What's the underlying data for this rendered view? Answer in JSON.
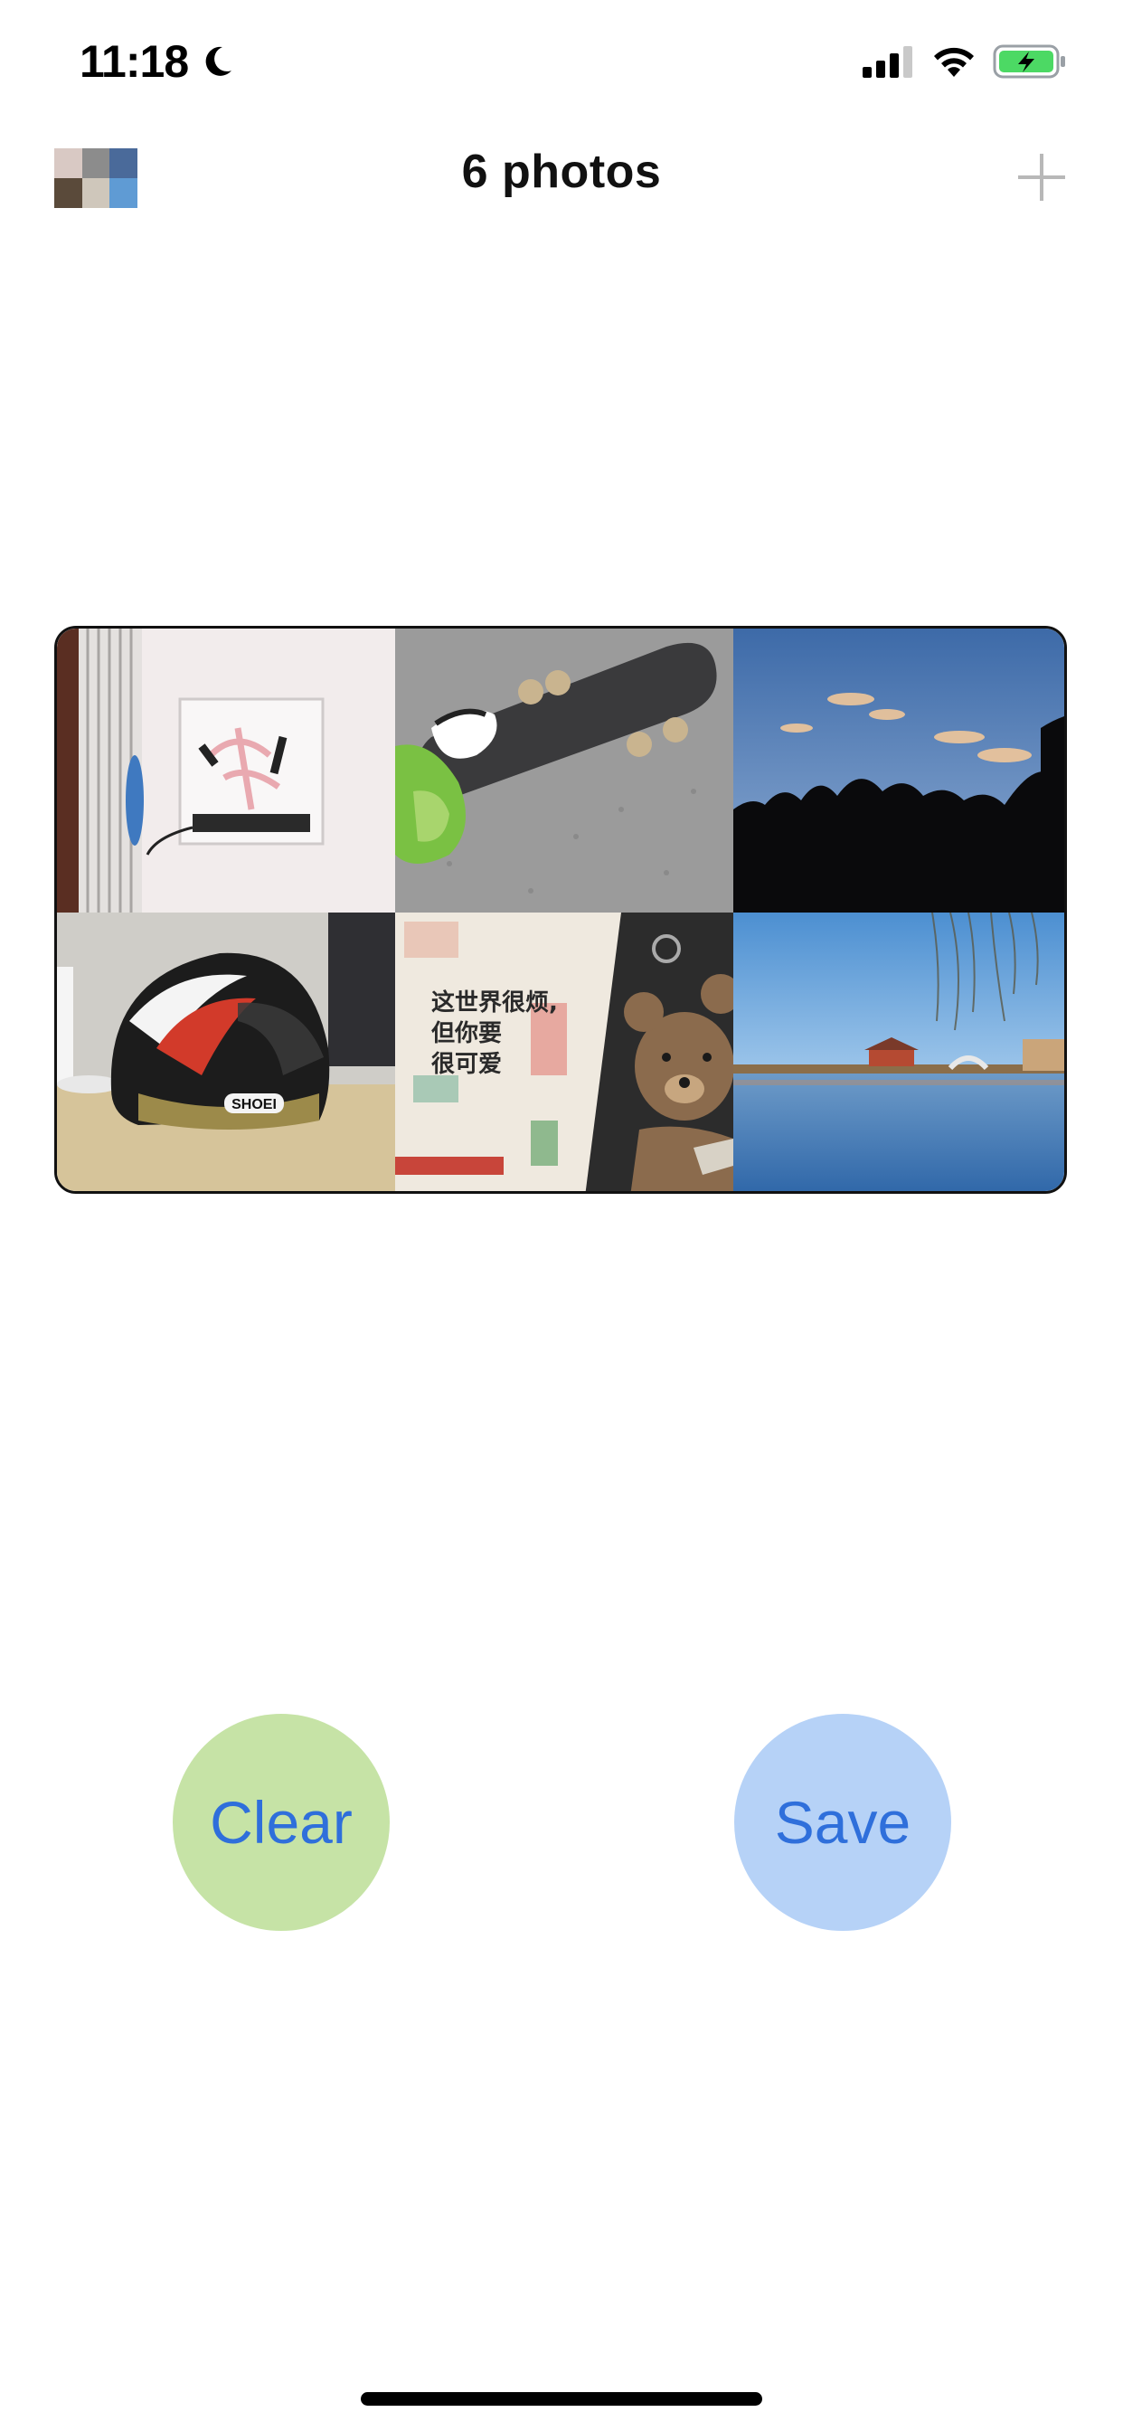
{
  "status_bar": {
    "time": "11:18",
    "icons": [
      "moon-icon",
      "cellular-signal-icon",
      "wifi-icon",
      "battery-charging-icon"
    ],
    "battery_color": "#4cd964"
  },
  "nav": {
    "title": "6 photos",
    "thumbnail_icon": "collage-thumbnail",
    "add_icon": "plus-icon"
  },
  "collage": {
    "tiles": [
      {
        "name": "neon-sign-photo"
      },
      {
        "name": "skateboard-photo"
      },
      {
        "name": "sunset-trees-photo"
      },
      {
        "name": "helmet-photo",
        "label": "SHOEI"
      },
      {
        "name": "book-teddy-bear-photo",
        "label": "这世界很烦，但你要很可爱"
      },
      {
        "name": "lake-pavilion-photo"
      }
    ]
  },
  "actions": {
    "clear_label": "Clear",
    "save_label": "Save",
    "clear_color": "#c6e3a6",
    "save_color": "#b6d2f7",
    "label_color": "#2f6fdb"
  }
}
